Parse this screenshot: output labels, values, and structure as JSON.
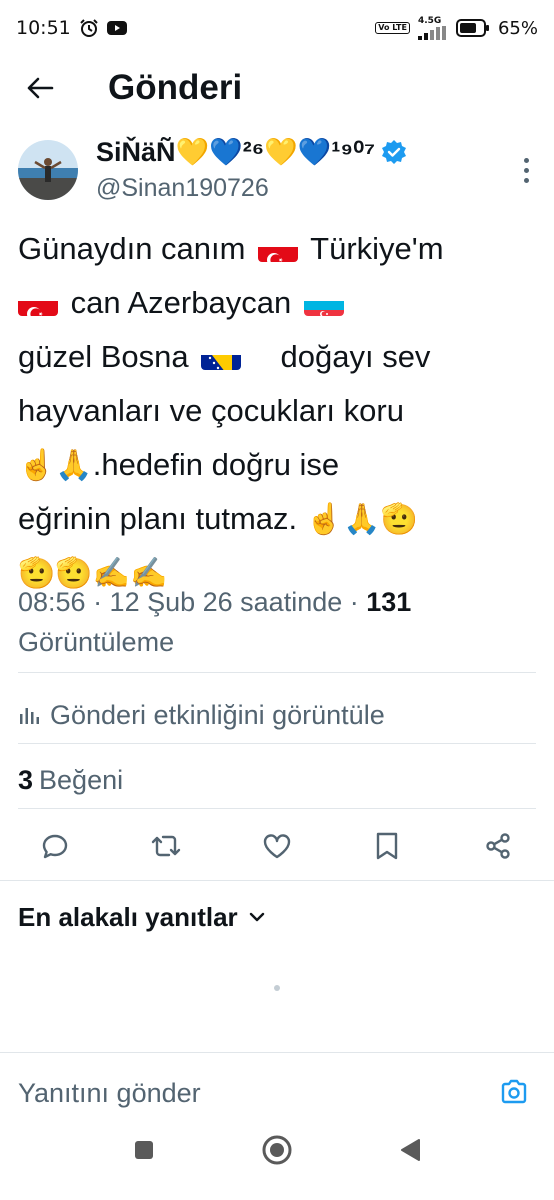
{
  "status_bar": {
    "time": "10:51",
    "network_type": "4.5G",
    "volte_label": "Vo LTE",
    "battery": "65%",
    "icons": [
      "alarm-icon",
      "youtube-icon",
      "signal-icon",
      "battery-icon"
    ]
  },
  "header": {
    "title": "Gönderi",
    "back_icon": "arrow-left-icon"
  },
  "post": {
    "author": {
      "display_name": "SiŇäÑ💛💙²⁶💛💙¹⁹⁰⁷",
      "handle": "@Sinan190726",
      "verified": true
    },
    "text_lines": [
      "Günaydın canım",
      "Türkiye'm",
      "can Azerbaycan",
      "güzel Bosna",
      "doğayı sev",
      "hayvanları ve çocukları koru",
      ".hedefin doğru ise",
      "eğrinin planı tutmaz.",
      "☝🙏",
      "🫡",
      "🫡🫡✍✍"
    ],
    "meta": {
      "time_date": "08:56 · 12 Şub 26 saatinde · ",
      "views_count": "131",
      "views_label": "Görüntüleme"
    },
    "activity_label": "Gönderi etkinliğini görüntüle",
    "likes": {
      "count": "3",
      "label": "Beğeni"
    },
    "actions": [
      "reply-icon",
      "repost-icon",
      "like-icon",
      "bookmark-icon",
      "share-icon"
    ]
  },
  "replies": {
    "sort_label": "En alakalı yanıtlar"
  },
  "composer": {
    "placeholder": "Yanıtını gönder"
  },
  "colors": {
    "text_primary": "#0f1419",
    "text_secondary": "#536471",
    "accent": "#1d9bf0",
    "divider": "#e1e6ea"
  }
}
